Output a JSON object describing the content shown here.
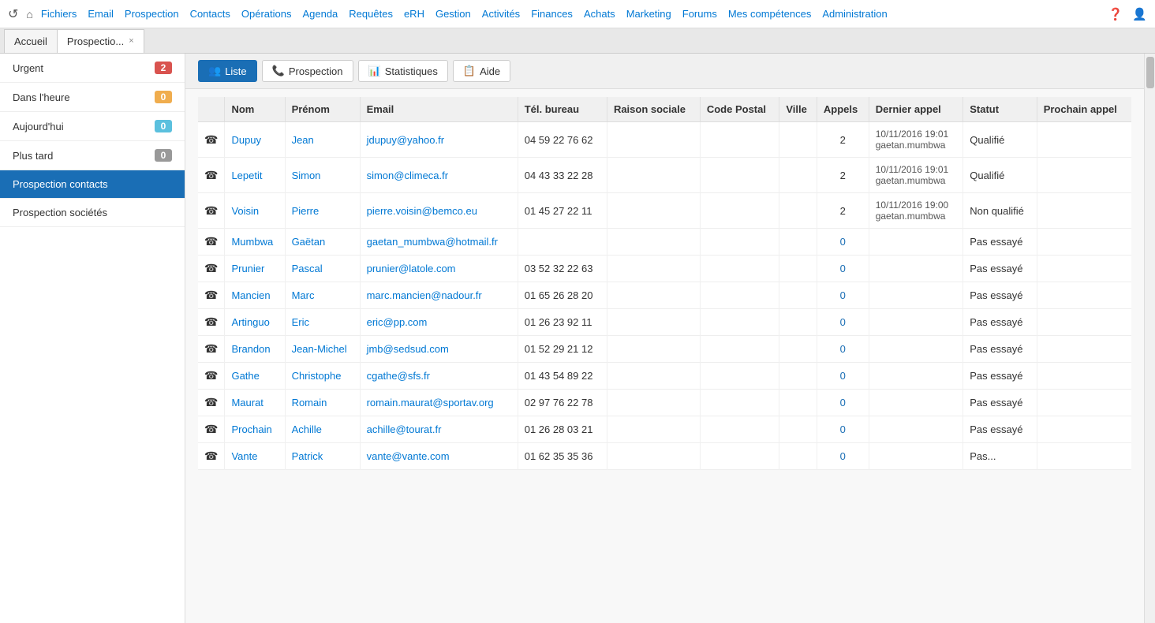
{
  "topnav": {
    "links": [
      {
        "label": "Fichiers",
        "key": "fichiers"
      },
      {
        "label": "Email",
        "key": "email"
      },
      {
        "label": "Prospection",
        "key": "prospection"
      },
      {
        "label": "Contacts",
        "key": "contacts"
      },
      {
        "label": "Opérations",
        "key": "operations"
      },
      {
        "label": "Agenda",
        "key": "agenda"
      },
      {
        "label": "Requêtes",
        "key": "requetes"
      },
      {
        "label": "eRH",
        "key": "erh"
      },
      {
        "label": "Gestion",
        "key": "gestion"
      },
      {
        "label": "Activités",
        "key": "activites"
      },
      {
        "label": "Finances",
        "key": "finances"
      },
      {
        "label": "Achats",
        "key": "achats"
      },
      {
        "label": "Marketing",
        "key": "marketing"
      },
      {
        "label": "Forums",
        "key": "forums"
      },
      {
        "label": "Mes compétences",
        "key": "competences"
      },
      {
        "label": "Administration",
        "key": "administration"
      }
    ]
  },
  "tabs": [
    {
      "label": "Accueil",
      "key": "accueil",
      "closable": false,
      "active": false
    },
    {
      "label": "Prospectio...",
      "key": "prospection",
      "closable": true,
      "active": true
    }
  ],
  "sidebar": {
    "items": [
      {
        "label": "Urgent",
        "badge": "2",
        "badge_type": "red",
        "key": "urgent",
        "active": false
      },
      {
        "label": "Dans l'heure",
        "badge": "0",
        "badge_type": "orange",
        "key": "dans-heure",
        "active": false
      },
      {
        "label": "Aujourd'hui",
        "badge": "0",
        "badge_type": "blue",
        "key": "aujourd-hui",
        "active": false
      },
      {
        "label": "Plus tard",
        "badge": "0",
        "badge_type": "gray",
        "key": "plus-tard",
        "active": false
      },
      {
        "label": "Prospection contacts",
        "badge": "",
        "badge_type": "",
        "key": "prospection-contacts",
        "active": true
      },
      {
        "label": "Prospection sociétés",
        "badge": "",
        "badge_type": "",
        "key": "prospection-societes",
        "active": false
      }
    ]
  },
  "toolbar": {
    "buttons": [
      {
        "label": "Liste",
        "key": "liste",
        "active": true,
        "icon": "👥"
      },
      {
        "label": "Prospection",
        "key": "prospection",
        "active": false,
        "icon": "📞"
      },
      {
        "label": "Statistiques",
        "key": "statistiques",
        "active": false,
        "icon": "📊"
      },
      {
        "label": "Aide",
        "key": "aide",
        "active": false,
        "icon": "📋"
      }
    ]
  },
  "table": {
    "columns": [
      "",
      "Nom",
      "Prénom",
      "Email",
      "Tél. bureau",
      "Raison sociale",
      "Code Postal",
      "Ville",
      "Appels",
      "Dernier appel",
      "Statut",
      "Prochain appel"
    ],
    "rows": [
      {
        "nom": "Dupuy",
        "prenom": "Jean",
        "email": "jdupuy@yahoo.fr",
        "tel": "04 59 22 76 62",
        "raison": "",
        "cp": "",
        "ville": "",
        "appels": "2",
        "dernier": "10/11/2016 19:01 gaetan.mumbwa",
        "statut": "Qualifié",
        "prochain": ""
      },
      {
        "nom": "Lepetit",
        "prenom": "Simon",
        "email": "simon@climeca.fr",
        "tel": "04 43 33 22 28",
        "raison": "",
        "cp": "",
        "ville": "",
        "appels": "2",
        "dernier": "10/11/2016 19:01 gaetan.mumbwa",
        "statut": "Qualifié",
        "prochain": ""
      },
      {
        "nom": "Voisin",
        "prenom": "Pierre",
        "email": "pierre.voisin@bemco.eu",
        "tel": "01 45 27 22 11",
        "raison": "",
        "cp": "",
        "ville": "",
        "appels": "2",
        "dernier": "10/11/2016 19:00 gaetan.mumbwa",
        "statut": "Non qualifié",
        "prochain": ""
      },
      {
        "nom": "Mumbwa",
        "prenom": "Gaëtan",
        "email": "gaetan_mumbwa@hotmail.fr",
        "tel": "",
        "raison": "",
        "cp": "",
        "ville": "",
        "appels": "0",
        "dernier": "",
        "statut": "Pas essayé",
        "prochain": ""
      },
      {
        "nom": "Prunier",
        "prenom": "Pascal",
        "email": "prunier@latole.com",
        "tel": "03 52 32 22 63",
        "raison": "",
        "cp": "",
        "ville": "",
        "appels": "0",
        "dernier": "",
        "statut": "Pas essayé",
        "prochain": ""
      },
      {
        "nom": "Mancien",
        "prenom": "Marc",
        "email": "marc.mancien@nadour.fr",
        "tel": "01 65 26 28 20",
        "raison": "",
        "cp": "",
        "ville": "",
        "appels": "0",
        "dernier": "",
        "statut": "Pas essayé",
        "prochain": ""
      },
      {
        "nom": "Artinguo",
        "prenom": "Eric",
        "email": "eric@pp.com",
        "tel": "01 26 23 92 11",
        "raison": "",
        "cp": "",
        "ville": "",
        "appels": "0",
        "dernier": "",
        "statut": "Pas essayé",
        "prochain": ""
      },
      {
        "nom": "Brandon",
        "prenom": "Jean-Michel",
        "email": "jmb@sedsud.com",
        "tel": "01 52 29 21 12",
        "raison": "",
        "cp": "",
        "ville": "",
        "appels": "0",
        "dernier": "",
        "statut": "Pas essayé",
        "prochain": ""
      },
      {
        "nom": "Gathe",
        "prenom": "Christophe",
        "email": "cgathe@sfs.fr",
        "tel": "01 43 54 89 22",
        "raison": "",
        "cp": "",
        "ville": "",
        "appels": "0",
        "dernier": "",
        "statut": "Pas essayé",
        "prochain": ""
      },
      {
        "nom": "Maurat",
        "prenom": "Romain",
        "email": "romain.maurat@sportav.org",
        "tel": "02 97 76 22 78",
        "raison": "",
        "cp": "",
        "ville": "",
        "appels": "0",
        "dernier": "",
        "statut": "Pas essayé",
        "prochain": ""
      },
      {
        "nom": "Prochain",
        "prenom": "Achille",
        "email": "achille@tourat.fr",
        "tel": "01 26 28 03 21",
        "raison": "",
        "cp": "",
        "ville": "",
        "appels": "0",
        "dernier": "",
        "statut": "Pas essayé",
        "prochain": ""
      },
      {
        "nom": "Vante",
        "prenom": "Patrick",
        "email": "vante@vante.com",
        "tel": "01 62 35 35 36",
        "raison": "",
        "cp": "",
        "ville": "",
        "appels": "0",
        "dernier": "",
        "statut": "Pas...",
        "prochain": ""
      }
    ]
  }
}
